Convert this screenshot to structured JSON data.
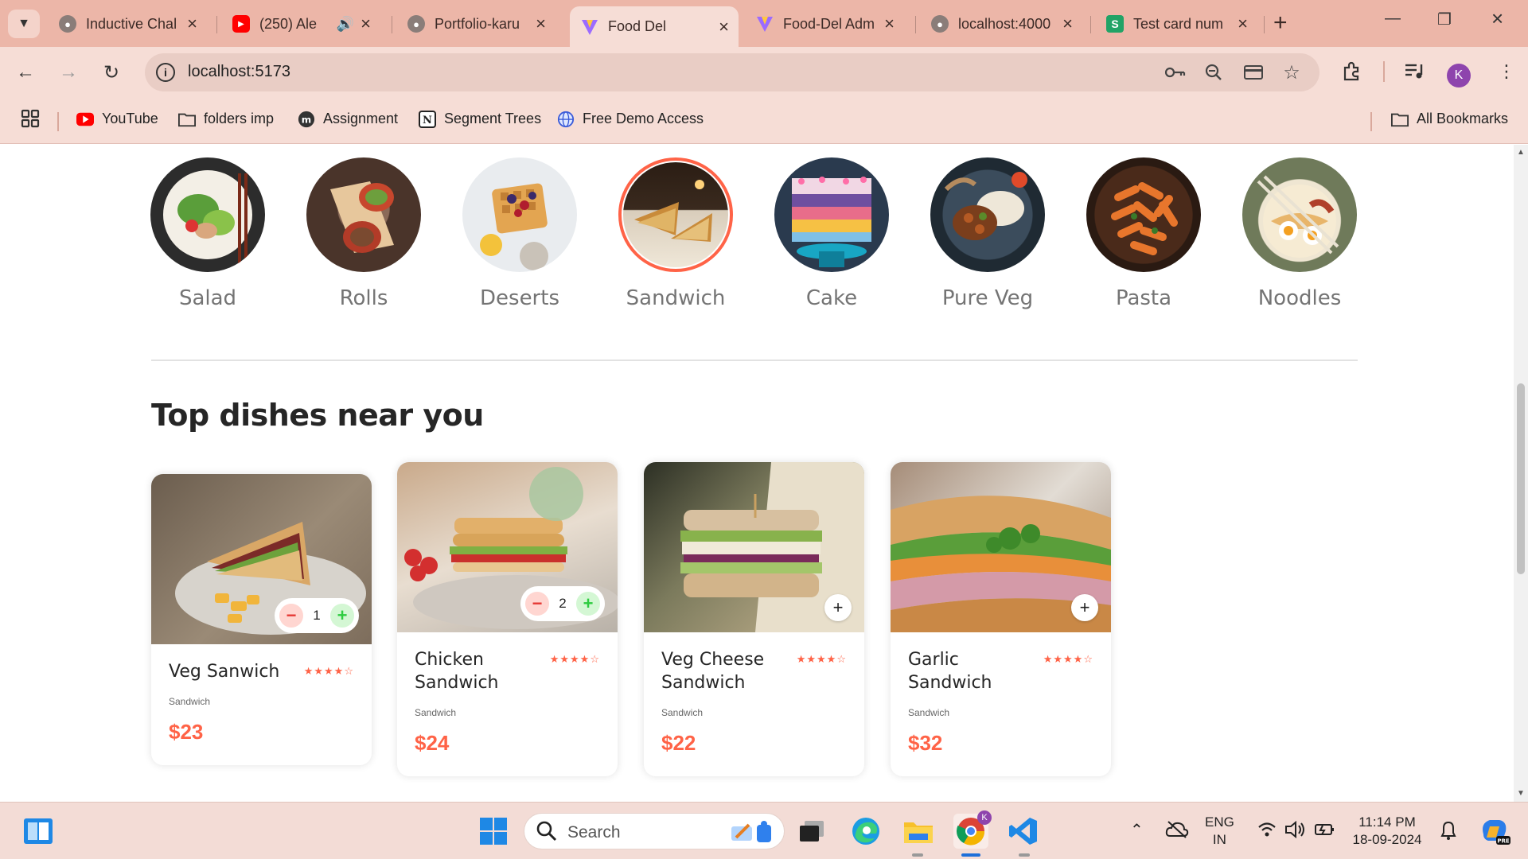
{
  "browser": {
    "tabs": [
      {
        "title": "Inductive Chal",
        "favicon": "globe-icon",
        "active": false
      },
      {
        "title": "(250) Ale",
        "favicon": "youtube-icon",
        "active": false
      },
      {
        "title": "Portfolio-karu",
        "favicon": "globe-icon",
        "active": false
      },
      {
        "title": "Food Del",
        "favicon": "vite-icon",
        "active": true
      },
      {
        "title": "Food-Del Adm",
        "favicon": "vite-icon",
        "active": false
      },
      {
        "title": "localhost:4000",
        "favicon": "globe-icon",
        "active": false
      },
      {
        "title": "Test card num",
        "favicon": "stripe-icon",
        "active": false
      }
    ],
    "url": "localhost:5173",
    "profile_initial": "K",
    "bookmarks": [
      {
        "label": "YouTube",
        "icon": "youtube-icon"
      },
      {
        "label": "folders imp",
        "icon": "folder-icon"
      },
      {
        "label": "Assignment",
        "icon": "medium-icon"
      },
      {
        "label": "Segment Trees",
        "icon": "notion-icon"
      },
      {
        "label": "Free Demo Access",
        "icon": "globe-icon"
      }
    ],
    "all_bookmarks": "All Bookmarks"
  },
  "menu": {
    "active": "Sandwich",
    "items": [
      {
        "label": "Salad"
      },
      {
        "label": "Rolls"
      },
      {
        "label": "Deserts"
      },
      {
        "label": "Sandwich"
      },
      {
        "label": "Cake"
      },
      {
        "label": "Pure Veg"
      },
      {
        "label": "Pasta"
      },
      {
        "label": "Noodles"
      }
    ]
  },
  "section_title": "Top dishes near you",
  "dishes": [
    {
      "name": "Veg Sanwich",
      "category": "Sandwich",
      "price": "$23",
      "rating": "★★★★☆",
      "qty": "1"
    },
    {
      "name": "Chicken Sandwich",
      "category": "Sandwich",
      "price": "$24",
      "rating": "★★★★☆",
      "qty": "2"
    },
    {
      "name": "Veg Cheese Sandwich",
      "category": "Sandwich",
      "price": "$22",
      "rating": "★★★★☆",
      "qty": ""
    },
    {
      "name": "Garlic Sandwich",
      "category": "Sandwich",
      "price": "$32",
      "rating": "★★★★☆",
      "qty": ""
    }
  ],
  "taskbar": {
    "search_placeholder": "Search",
    "lang_top": "ENG",
    "lang_bottom": "IN",
    "time": "11:14 PM",
    "date": "18-09-2024"
  },
  "colors": {
    "accent": "#ff6347",
    "tabstrip": "#ecb6a8",
    "toolbar": "#f6ddd6"
  }
}
